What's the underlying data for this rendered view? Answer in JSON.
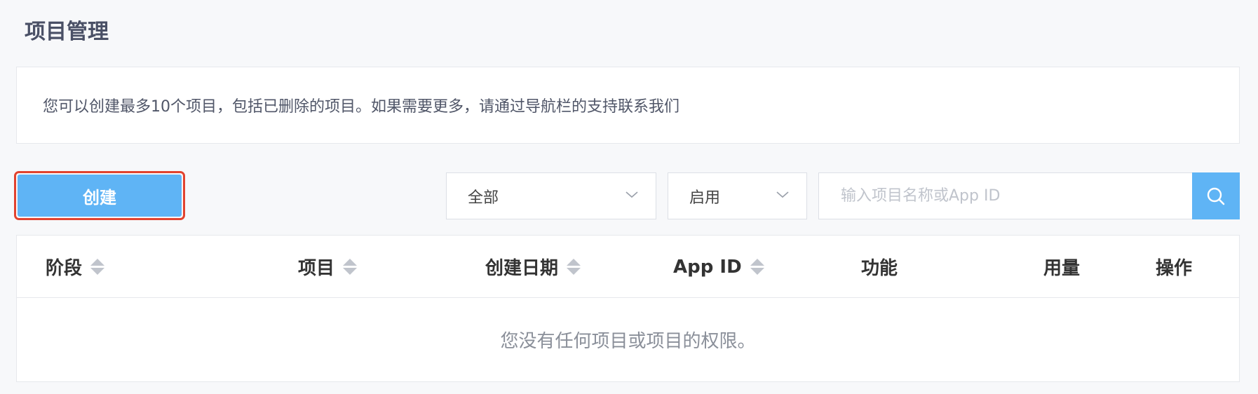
{
  "page": {
    "title": "项目管理"
  },
  "notice": {
    "text": "您可以创建最多10个项目，包括已删除的项目。如果需要更多，请通过导航栏的支持联系我们"
  },
  "toolbar": {
    "create_label": "创建",
    "filter_all": "全部",
    "filter_status": "启用",
    "search_placeholder": "输入项目名称或App ID",
    "search_icon": "search-icon"
  },
  "table": {
    "columns": [
      {
        "label": "阶段",
        "sortable": true
      },
      {
        "label": "项目",
        "sortable": true
      },
      {
        "label": "创建日期",
        "sortable": true
      },
      {
        "label": "App ID",
        "sortable": true
      },
      {
        "label": "功能",
        "sortable": false
      },
      {
        "label": "用量",
        "sortable": false
      },
      {
        "label": "操作",
        "sortable": false
      }
    ],
    "empty_text": "您没有任何项目或项目的权限。"
  },
  "colors": {
    "primary": "#5fb4f5",
    "highlight_border": "#e2432f",
    "title": "#4a5066"
  }
}
